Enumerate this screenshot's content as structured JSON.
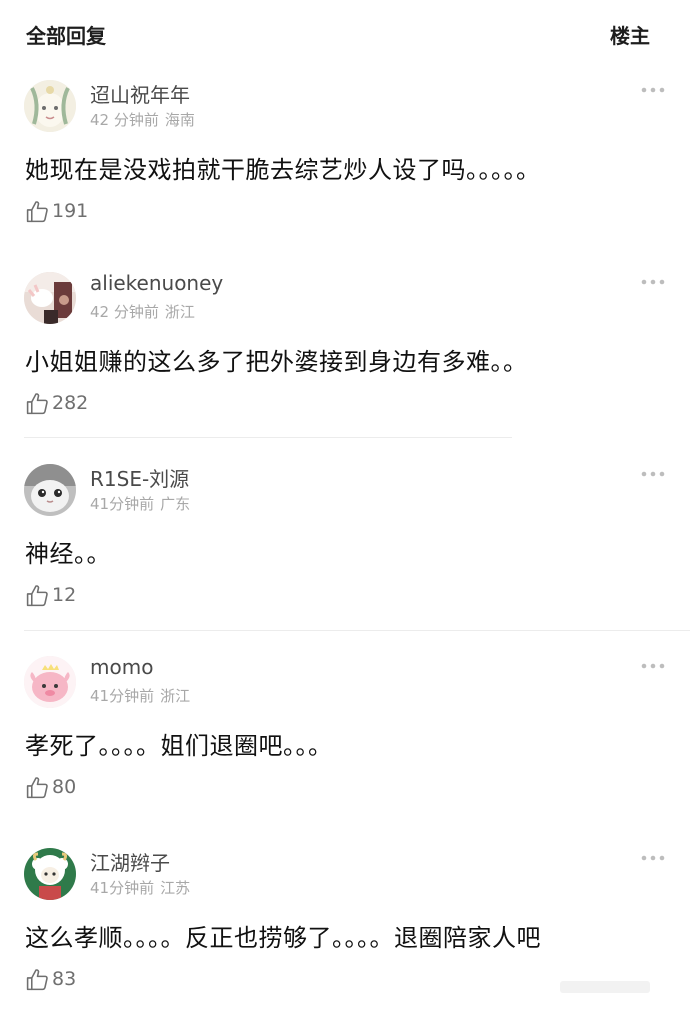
{
  "tabs": {
    "all_replies": "全部回复",
    "op_only": "楼主"
  },
  "comments": [
    {
      "username": "迢山祝年年",
      "time": "42 分钟前",
      "location": "海南",
      "text": "她现在是没戏拍就干脆去综艺炒人设了吗。。。。。",
      "likes": "191",
      "avatar_icon": "avatar-illustration-icon"
    },
    {
      "username": "aliekenuoney",
      "time": "42 分钟前",
      "location": "浙江",
      "text": "小姐姐赚的这么多了把外婆接到身边有多难。。",
      "likes": "282",
      "avatar_icon": "avatar-photo-icon"
    },
    {
      "username": "R1SE-刘源",
      "time": "41分钟前",
      "location": "广东",
      "text": "神经。。",
      "likes": "12",
      "avatar_icon": "avatar-cat-icon"
    },
    {
      "username": "momo",
      "time": "41分钟前",
      "location": "浙江",
      "text": "孝死了。。。。姐们退圈吧。。。",
      "likes": "80",
      "avatar_icon": "avatar-pink-creature-icon"
    },
    {
      "username": "江湖辫子",
      "time": "41分钟前",
      "location": "江苏",
      "text": "这么孝顺。。。。反正也捞够了。。。。退圈陪家人吧",
      "likes": "83",
      "avatar_icon": "avatar-sheep-icon"
    }
  ],
  "colors": {
    "username": "#4a4a4a",
    "meta": "#a8a8a8",
    "text": "#111111",
    "like": "#6f6f6f",
    "divider": "#ececec"
  }
}
